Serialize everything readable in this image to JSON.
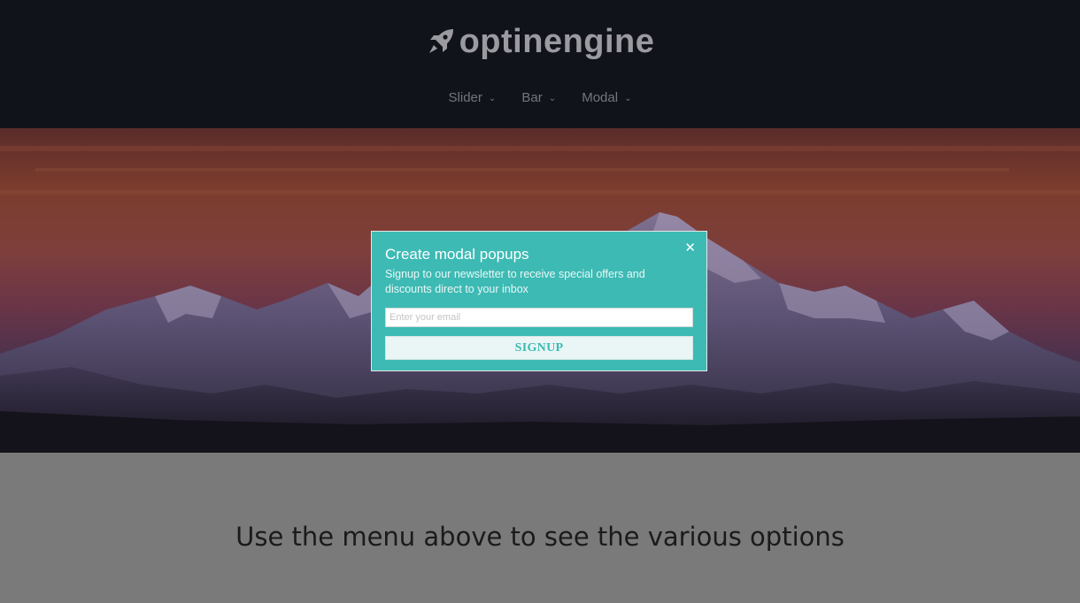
{
  "header": {
    "logo_text": "optinengine",
    "logo_icon": "rocket-icon"
  },
  "nav": {
    "items": [
      {
        "label": "Slider",
        "icon": "chevron-down-icon"
      },
      {
        "label": "Bar",
        "icon": "chevron-down-icon"
      },
      {
        "label": "Modal",
        "icon": "chevron-down-icon"
      }
    ]
  },
  "modal": {
    "title": "Create modal popups",
    "description": "Signup to our newsletter to receive special offers and discounts direct to your inbox",
    "close_icon": "close-icon",
    "email_placeholder": "Enter your email",
    "button_label": "SIGNUP",
    "accent_color": "#3dbab4"
  },
  "content": {
    "text": "Use the menu above to see the various options"
  }
}
